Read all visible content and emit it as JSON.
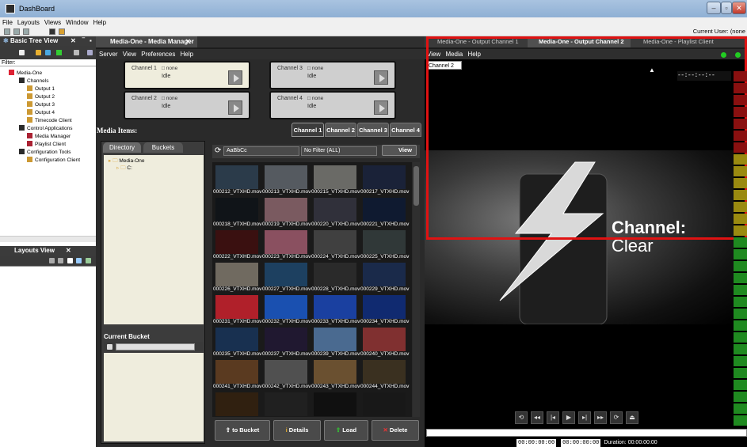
{
  "window": {
    "title": "DashBoard",
    "buttons": [
      "–",
      "▫",
      "✕"
    ]
  },
  "menu": [
    "File",
    "Layouts",
    "Views",
    "Window",
    "Help"
  ],
  "current_user": "Current User: (none",
  "left_panel": {
    "title": "Basic Tree View",
    "filter_label": "Filter:",
    "tree": [
      {
        "label": "Media-One",
        "indent": 0
      },
      {
        "label": "Channels",
        "indent": 1
      },
      {
        "label": "Output 1",
        "indent": 2
      },
      {
        "label": "Output 2",
        "indent": 2
      },
      {
        "label": "Output 3",
        "indent": 2
      },
      {
        "label": "Output 4",
        "indent": 2
      },
      {
        "label": "Timecode Client",
        "indent": 2
      },
      {
        "label": "Control Applications",
        "indent": 1
      },
      {
        "label": "Media Manager",
        "indent": 2
      },
      {
        "label": "Playlist Client",
        "indent": 2
      },
      {
        "label": "Configuration Tools",
        "indent": 1
      },
      {
        "label": "Configuration Client",
        "indent": 2
      }
    ],
    "layouts_title": "Layouts View"
  },
  "media_manager": {
    "tab": "Media-One - Media Manager",
    "menu": [
      "Server",
      "View",
      "Preferences",
      "Help"
    ],
    "channels": [
      {
        "title": "Channel 1",
        "none": "□ none",
        "status": "Idle"
      },
      {
        "title": "Channel 3",
        "none": "□ none",
        "status": "Idle"
      },
      {
        "title": "Channel 2",
        "none": "□ none",
        "status": "Idle"
      },
      {
        "title": "Channel 4",
        "none": "□ none",
        "status": "Idle"
      }
    ],
    "media_items_label": "Media Items:",
    "channel_tabs": [
      "Channel 1",
      "Channel 2",
      "Channel 3",
      "Channel 4"
    ],
    "sub_tabs": [
      "Directory",
      "Buckets"
    ],
    "dir_tree": [
      "Media-One",
      "C:"
    ],
    "current_bucket_label": "Current Bucket",
    "search_value": "AaBbCc",
    "filter_value": "No Filter (ALL)",
    "view_label": "View",
    "thumbnails": [
      "000212_VTXHD.mov",
      "000213_VTXHD.mov",
      "000215_VTXHD.mov",
      "000217_VTXHD.mov",
      "000218_VTXHD.mov",
      "000219_VTXHD.mov",
      "000220_VTXHD.mov",
      "000221_VTXHD.mov",
      "000222_VTXHD.mov",
      "000223_VTXHD.mov",
      "000224_VTXHD.mov",
      "000225_VTXHD.mov",
      "000226_VTXHD.mov",
      "000227_VTXHD.mov",
      "000228_VTXHD.mov",
      "000229_VTXHD.mov",
      "000231_VTXHD.mov",
      "000232_VTXHD.mov",
      "000233_VTXHD.mov",
      "000234_VTXHD.mov",
      "000235_VTXHD.mov",
      "000237_VTXHD.mov",
      "000239_VTXHD.mov",
      "000240_VTXHD.mov",
      "000241_VTXHD.mov",
      "000242_VTXHD.mov",
      "000243_VTXHD.mov",
      "000244_VTXHD.mov",
      "",
      "",
      "",
      ""
    ],
    "thumb_colors": [
      "#2b3b4a",
      "#555a60",
      "#6a6a66",
      "#1a2238",
      "#101418",
      "#7a5a60",
      "#30303a",
      "#0f1a30",
      "#3a1010",
      "#8a5060",
      "#404040",
      "#303838",
      "#706a60",
      "#1d4060",
      "#2a2a2a",
      "#1a2a4a",
      "#b0202a",
      "#1a50b0",
      "#1a40a0",
      "#102a70",
      "#183050",
      "#201830",
      "#4a6a90",
      "#803030",
      "#5a3a20",
      "#505050",
      "#6a5030",
      "#3a3020",
      "#302010",
      "#202020",
      "#101010",
      "#181818"
    ],
    "actions": [
      "to Bucket",
      "Details",
      "Load",
      "Delete"
    ]
  },
  "output": {
    "tabs": [
      "Media-One - Output Channel 1",
      "Media-One - Output Channel 2",
      "Media-One - Playlist Client"
    ],
    "menu": [
      "View",
      "Media",
      "Help"
    ],
    "channel_select": "Channel 2",
    "timecode_overlay": "--:--:--:--",
    "channel_line1": "Channel:",
    "channel_line2": "Clear",
    "transport": [
      "⟲",
      "◂◂",
      "|◂",
      "▶",
      "▸|",
      "▸▸",
      "⟳",
      "⏏"
    ],
    "tc_in": "00:00:00:00",
    "tc_out": "00:00:00:00",
    "duration": "Duration: 00:00:00:00"
  }
}
